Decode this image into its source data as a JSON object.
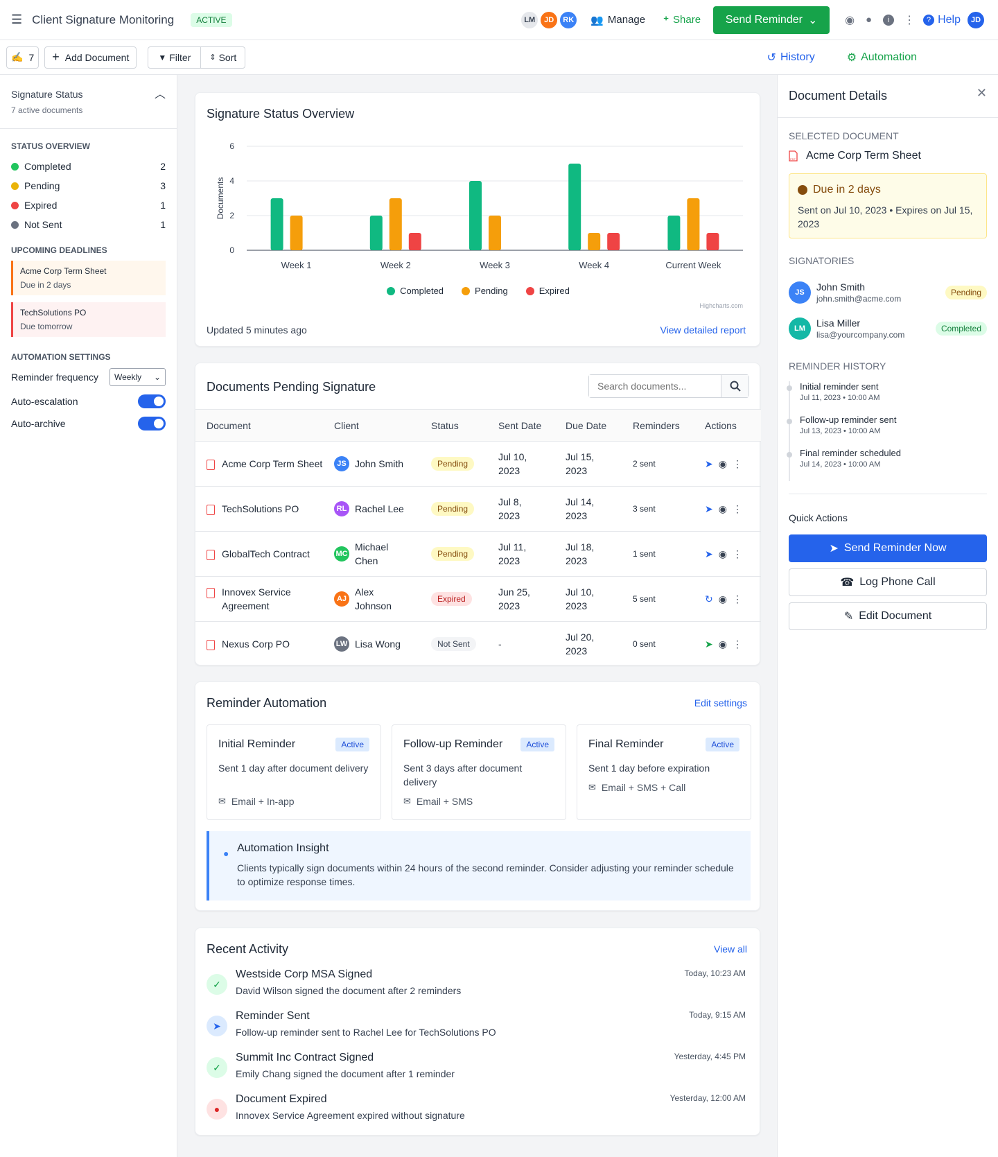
{
  "app": {
    "title": "Client Signature Monitoring",
    "status": "ACTIVE",
    "avatars": [
      "LM",
      "JD",
      "RK"
    ],
    "manage": "Manage",
    "share": "Share",
    "send_reminder": "Send Reminder",
    "help": "Help",
    "user": "JD"
  },
  "toolbar": {
    "count": "7",
    "add_document": "Add Document",
    "filter": "Filter",
    "sort": "Sort",
    "history": "History",
    "automation": "Automation"
  },
  "sidebar": {
    "title": "Signature Status",
    "subtitle": "7 active documents",
    "overview_title": "STATUS OVERVIEW",
    "statuses": [
      {
        "label": "Completed",
        "count": "2",
        "color": "#22c55e"
      },
      {
        "label": "Pending",
        "count": "3",
        "color": "#eab308"
      },
      {
        "label": "Expired",
        "count": "1",
        "color": "#ef4444"
      },
      {
        "label": "Not Sent",
        "count": "1",
        "color": "#6b7280"
      }
    ],
    "deadlines_title": "UPCOMING DEADLINES",
    "deadlines": [
      {
        "name": "Acme Corp Term Sheet",
        "due": "Due in 2 days"
      },
      {
        "name": "TechSolutions PO",
        "due": "Due tomorrow"
      }
    ],
    "automation_title": "AUTOMATION SETTINGS",
    "frequency_label": "Reminder frequency",
    "frequency_value": "Weekly",
    "escalation": "Auto-escalation",
    "archive": "Auto-archive"
  },
  "overview": {
    "title": "Signature Status Overview",
    "updated": "Updated 5 minutes ago",
    "link": "View detailed report",
    "credit": "Highcharts.com"
  },
  "chart_data": {
    "type": "bar",
    "categories": [
      "Week 1",
      "Week 2",
      "Week 3",
      "Week 4",
      "Current Week"
    ],
    "ylabel": "Documents",
    "ylim": [
      0,
      6
    ],
    "yticks": [
      0,
      2,
      4,
      6
    ],
    "series": [
      {
        "name": "Completed",
        "color": "#10b981",
        "values": [
          3,
          2,
          4,
          5,
          2
        ]
      },
      {
        "name": "Pending",
        "color": "#f59e0b",
        "values": [
          2,
          3,
          2,
          1,
          3
        ]
      },
      {
        "name": "Expired",
        "color": "#ef4444",
        "values": [
          0,
          1,
          0,
          1,
          1
        ]
      }
    ]
  },
  "pending": {
    "title": "Documents Pending Signature",
    "search_placeholder": "Search documents...",
    "columns": [
      "Document",
      "Client",
      "Status",
      "Sent Date",
      "Due Date",
      "Reminders",
      "Actions"
    ],
    "rows": [
      {
        "doc": "Acme Corp Term Sheet",
        "initials": "JS",
        "client": "John Smith",
        "avatar_color": "#3b82f6",
        "status": "Pending",
        "sent": "Jul 10, 2023",
        "due": "Jul 15, 2023",
        "reminders": "2 sent",
        "action_color": "#2563eb"
      },
      {
        "doc": "TechSolutions PO",
        "initials": "RL",
        "client": "Rachel Lee",
        "avatar_color": "#a855f7",
        "status": "Pending",
        "sent": "Jul 8, 2023",
        "due": "Jul 14, 2023",
        "reminders": "3 sent",
        "action_color": "#2563eb"
      },
      {
        "doc": "GlobalTech Contract",
        "initials": "MC",
        "client": "Michael Chen",
        "avatar_color": "#22c55e",
        "status": "Pending",
        "sent": "Jul 11, 2023",
        "due": "Jul 18, 2023",
        "reminders": "1 sent",
        "action_color": "#2563eb"
      },
      {
        "doc": "Innovex Service Agreement",
        "initials": "AJ",
        "client": "Alex Johnson",
        "avatar_color": "#f97316",
        "status": "Expired",
        "sent": "Jun 25, 2023",
        "due": "Jul 10, 2023",
        "reminders": "5 sent",
        "action_color": "#2563eb"
      },
      {
        "doc": "Nexus Corp PO",
        "initials": "LW",
        "client": "Lisa Wong",
        "avatar_color": "#6b7280",
        "status": "Not Sent",
        "sent": "-",
        "due": "Jul 20, 2023",
        "reminders": "0 sent",
        "action_color": "#16a34a"
      }
    ]
  },
  "automation": {
    "title": "Reminder Automation",
    "edit": "Edit settings",
    "rules": [
      {
        "name": "Initial Reminder",
        "badge": "Active",
        "desc": "Sent 1 day after document delivery",
        "channels": "Email + In-app"
      },
      {
        "name": "Follow-up Reminder",
        "badge": "Active",
        "desc": "Sent 3 days after document delivery",
        "channels": "Email + SMS"
      },
      {
        "name": "Final Reminder",
        "badge": "Active",
        "desc": "Sent 1 day before expiration",
        "channels": "Email + SMS + Call"
      }
    ],
    "insight_title": "Automation Insight",
    "insight_text": "Clients typically sign documents within 24 hours of the second reminder. Consider adjusting your reminder schedule to optimize response times."
  },
  "activity": {
    "title": "Recent Activity",
    "view_all": "View all",
    "items": [
      {
        "title": "Westside Corp MSA Signed",
        "desc": "David Wilson signed the document after 2 reminders",
        "time": "Today, 10:23 AM",
        "kind": "check"
      },
      {
        "title": "Reminder Sent",
        "desc": "Follow-up reminder sent to Rachel Lee for TechSolutions PO",
        "time": "Today, 9:15 AM",
        "kind": "send"
      },
      {
        "title": "Summit Inc Contract Signed",
        "desc": "Emily Chang signed the document after 1 reminder",
        "time": "Yesterday, 4:45 PM",
        "kind": "check"
      },
      {
        "title": "Document Expired",
        "desc": "Innovex Service Agreement expired without signature",
        "time": "Yesterday, 12:00 AM",
        "kind": "expired"
      }
    ]
  },
  "details": {
    "title": "Document Details",
    "selected_label": "SELECTED DOCUMENT",
    "doc_name": "Acme Corp Term Sheet",
    "due": "Due in 2 days",
    "due_info": "Sent on Jul 10, 2023 • Expires on Jul 15, 2023",
    "signatories_label": "SIGNATORIES",
    "signatories": [
      {
        "initials": "JS",
        "name": "John Smith",
        "email": "john.smith@acme.com",
        "status": "Pending",
        "color": "#3b82f6"
      },
      {
        "initials": "LM",
        "name": "Lisa Miller",
        "email": "lisa@yourcompany.com",
        "status": "Completed",
        "color": "#14b8a6"
      }
    ],
    "history_label": "REMINDER HISTORY",
    "history": [
      {
        "title": "Initial reminder sent",
        "time": "Jul 11, 2023 • 10:00 AM"
      },
      {
        "title": "Follow-up reminder sent",
        "time": "Jul 13, 2023 • 10:00 AM"
      },
      {
        "title": "Final reminder scheduled",
        "time": "Jul 14, 2023 • 10:00 AM"
      }
    ],
    "quick_label": "Quick Actions",
    "send_now": "Send Reminder Now",
    "log_call": "Log Phone Call",
    "edit_doc": "Edit Document"
  }
}
